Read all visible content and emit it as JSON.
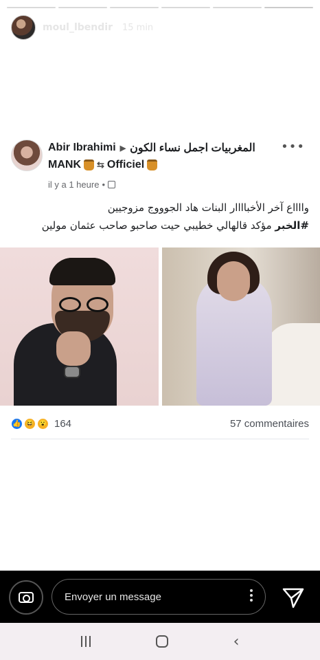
{
  "story": {
    "username": "moul_lbendir",
    "time": "15 min",
    "segments": 6
  },
  "post": {
    "author": "Abir Ibrahimi",
    "group_part1": "المغربيات اجمل نساء الكون",
    "group_part2_a": "MANK",
    "group_part2_b": "Officiel",
    "more": "•••",
    "timestamp": "il y a 1 heure",
    "meta_sep": "•",
    "text_line1": "وااااع آخر الأخباااار البنات هاد الجوووج مزوجيين",
    "text_line2_tag": "#الخبر",
    "text_line2_rest": " مؤكد قالهالي خطيبي حيت صاحبو صاحب عثمان مولين",
    "reaction_count": "164",
    "comments": "57 commentaires"
  },
  "message_bar": {
    "placeholder": "Envoyer un message"
  },
  "colors": {
    "accent_like": "#1877f2",
    "reaction_yellow": "#f7b125",
    "bar_bg": "#000000"
  },
  "icons": {
    "camera": "camera-icon",
    "send": "send-icon",
    "globe": "globe-icon",
    "more": "more-icon"
  }
}
